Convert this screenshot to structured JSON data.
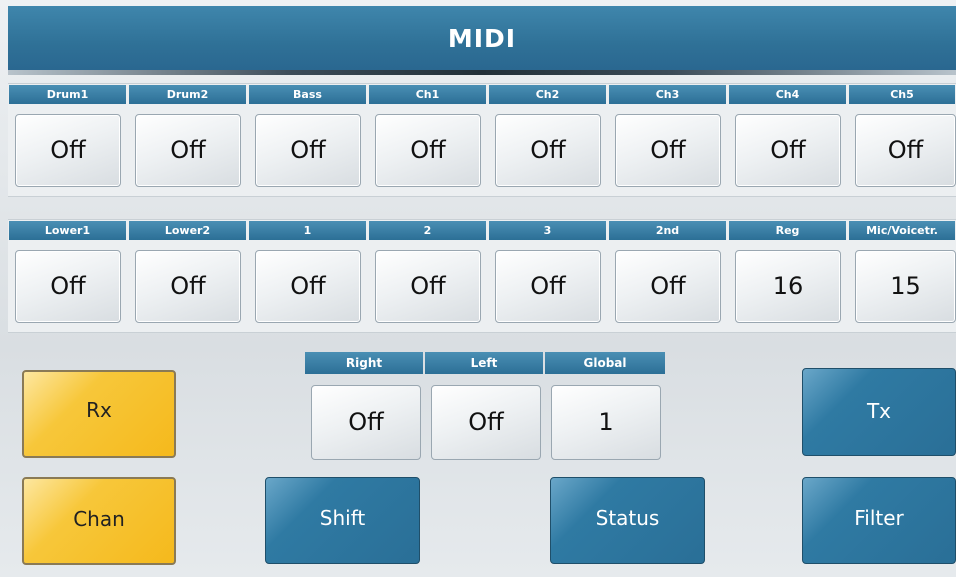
{
  "title": "MIDI",
  "row1": [
    {
      "label": "Drum1",
      "value": "Off"
    },
    {
      "label": "Drum2",
      "value": "Off"
    },
    {
      "label": "Bass",
      "value": "Off"
    },
    {
      "label": "Ch1",
      "value": "Off"
    },
    {
      "label": "Ch2",
      "value": "Off"
    },
    {
      "label": "Ch3",
      "value": "Off"
    },
    {
      "label": "Ch4",
      "value": "Off"
    },
    {
      "label": "Ch5",
      "value": "Off"
    }
  ],
  "row2": [
    {
      "label": "Lower1",
      "value": "Off"
    },
    {
      "label": "Lower2",
      "value": "Off"
    },
    {
      "label": "1",
      "value": "Off"
    },
    {
      "label": "2",
      "value": "Off"
    },
    {
      "label": "3",
      "value": "Off"
    },
    {
      "label": "2nd",
      "value": "Off"
    },
    {
      "label": "Reg",
      "value": "16"
    },
    {
      "label": "Mic/Voicetr.",
      "value": "15"
    }
  ],
  "mid": [
    {
      "label": "Right",
      "value": "Off"
    },
    {
      "label": "Left",
      "value": "Off"
    },
    {
      "label": "Global",
      "value": "1"
    }
  ],
  "buttons": {
    "rx": "Rx",
    "chan": "Chan",
    "shift": "Shift",
    "status": "Status",
    "tx": "Tx",
    "filter": "Filter"
  }
}
